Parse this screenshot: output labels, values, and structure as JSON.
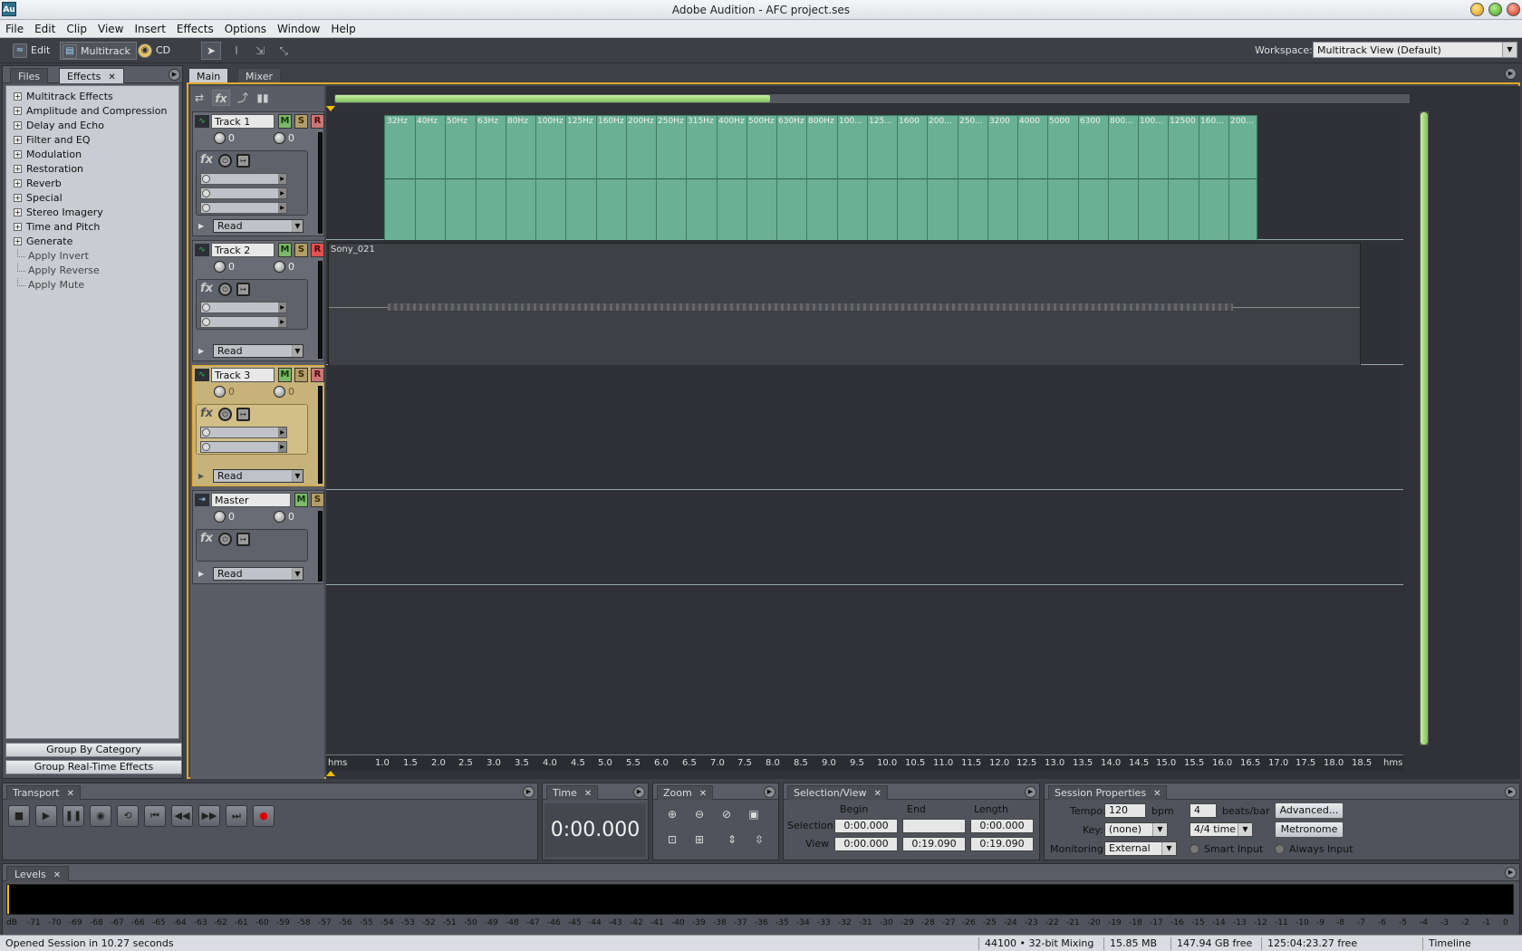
{
  "window": {
    "title": "Adobe Audition - AFC project.ses",
    "logo": "Au"
  },
  "menu": [
    "File",
    "Edit",
    "Clip",
    "View",
    "Insert",
    "Effects",
    "Options",
    "Window",
    "Help"
  ],
  "toolbar": {
    "edit": "Edit",
    "multitrack": "Multitrack",
    "cd": "CD",
    "workspace_label": "Workspace:",
    "workspace_value": "Multitrack View (Default)"
  },
  "left_panel": {
    "tabs": [
      "Files",
      "Effects"
    ],
    "tree": [
      "Multitrack Effects",
      "Amplitude and Compression",
      "Delay and Echo",
      "Filter and EQ",
      "Modulation",
      "Restoration",
      "Reverb",
      "Special",
      "Stereo Imagery",
      "Time and Pitch",
      "Generate"
    ],
    "leaves": [
      "Apply Invert",
      "Apply Reverse",
      "Apply Mute"
    ],
    "group_by_category": "Group By Category",
    "group_realtime": "Group Real-Time Effects"
  },
  "main_tabs": [
    "Main",
    "Mixer"
  ],
  "tracks": [
    {
      "name": "Track 1",
      "vol": "0",
      "pan": "0",
      "mode": "Read"
    },
    {
      "name": "Track 2",
      "vol": "0",
      "pan": "0",
      "mode": "Read"
    },
    {
      "name": "Track 3",
      "vol": "0",
      "pan": "0",
      "mode": "Read"
    },
    {
      "name": "Master",
      "vol": "0",
      "pan": "0",
      "mode": "Read"
    }
  ],
  "msr": {
    "m": "M",
    "s": "S",
    "r": "R"
  },
  "clip1_labels": [
    "32Hz",
    "40Hz",
    "50Hz",
    "63Hz",
    "80Hz",
    "100Hz",
    "125Hz",
    "160Hz",
    "200Hz",
    "250Hz",
    "315Hz",
    "400Hz",
    "500Hz",
    "630Hz",
    "800Hz",
    "100...",
    "125...",
    "1600",
    "200...",
    "250...",
    "3200",
    "4000",
    "5000",
    "6300",
    "800...",
    "100...",
    "12500",
    "160...",
    "200..."
  ],
  "clip2_name": "Sony_021",
  "ruler": [
    "hms",
    "1.0",
    "1.5",
    "2.0",
    "2.5",
    "3.0",
    "3.5",
    "4.0",
    "4.5",
    "5.0",
    "5.5",
    "6.0",
    "6.5",
    "7.0",
    "7.5",
    "8.0",
    "8.5",
    "9.0",
    "9.5",
    "10.0",
    "10.5",
    "11.0",
    "11.5",
    "12.0",
    "12.5",
    "13.0",
    "13.5",
    "14.0",
    "14.5",
    "15.0",
    "15.5",
    "16.0",
    "16.5",
    "17.0",
    "17.5",
    "18.0",
    "18.5",
    "hms"
  ],
  "transport": {
    "title": "Transport"
  },
  "time": {
    "title": "Time",
    "value": "0:00.000"
  },
  "zoom": {
    "title": "Zoom"
  },
  "selection": {
    "title": "Selection/View",
    "begin": "Begin",
    "end": "End",
    "length": "Length",
    "selection_label": "Selection",
    "view_label": "View",
    "sel_begin": "0:00.000",
    "sel_end": "",
    "sel_length": "0:00.000",
    "view_begin": "0:00.000",
    "view_end": "0:19.090",
    "view_length": "0:19.090"
  },
  "session": {
    "title": "Session Properties",
    "tempo_label": "Tempo:",
    "tempo": "120",
    "bpm": "bpm",
    "beats": "4",
    "beats_label": "beats/bar",
    "advanced": "Advanced...",
    "key_label": "Key:",
    "key": "(none)",
    "time_sig": "4/4 time",
    "metronome": "Metronome",
    "monitoring_label": "Monitoring:",
    "monitoring": "External",
    "smart_input": "Smart Input",
    "always_input": "Always Input"
  },
  "levels": {
    "title": "Levels",
    "scale": [
      "dB",
      "-71",
      "-70",
      "-69",
      "-68",
      "-67",
      "-66",
      "-65",
      "-64",
      "-63",
      "-62",
      "-61",
      "-60",
      "-59",
      "-58",
      "-57",
      "-56",
      "-55",
      "-54",
      "-53",
      "-52",
      "-51",
      "-50",
      "-49",
      "-48",
      "-47",
      "-46",
      "-45",
      "-44",
      "-43",
      "-42",
      "-41",
      "-40",
      "-39",
      "-38",
      "-37",
      "-36",
      "-35",
      "-34",
      "-33",
      "-32",
      "-31",
      "-30",
      "-29",
      "-28",
      "-27",
      "-26",
      "-25",
      "-24",
      "-23",
      "-22",
      "-21",
      "-20",
      "-19",
      "-18",
      "-17",
      "-16",
      "-15",
      "-14",
      "-13",
      "-12",
      "-11",
      "-10",
      "-9",
      "-8",
      "-7",
      "-6",
      "-5",
      "-4",
      "-3",
      "-2",
      "-1",
      "0"
    ]
  },
  "status": {
    "message": "Opened Session in 10.27 seconds",
    "rate": "44100 • 32-bit Mixing",
    "size": "15.85 MB",
    "free": "147.94 GB free",
    "time_free": "125:04:23.27 free",
    "mode": "Timeline"
  }
}
